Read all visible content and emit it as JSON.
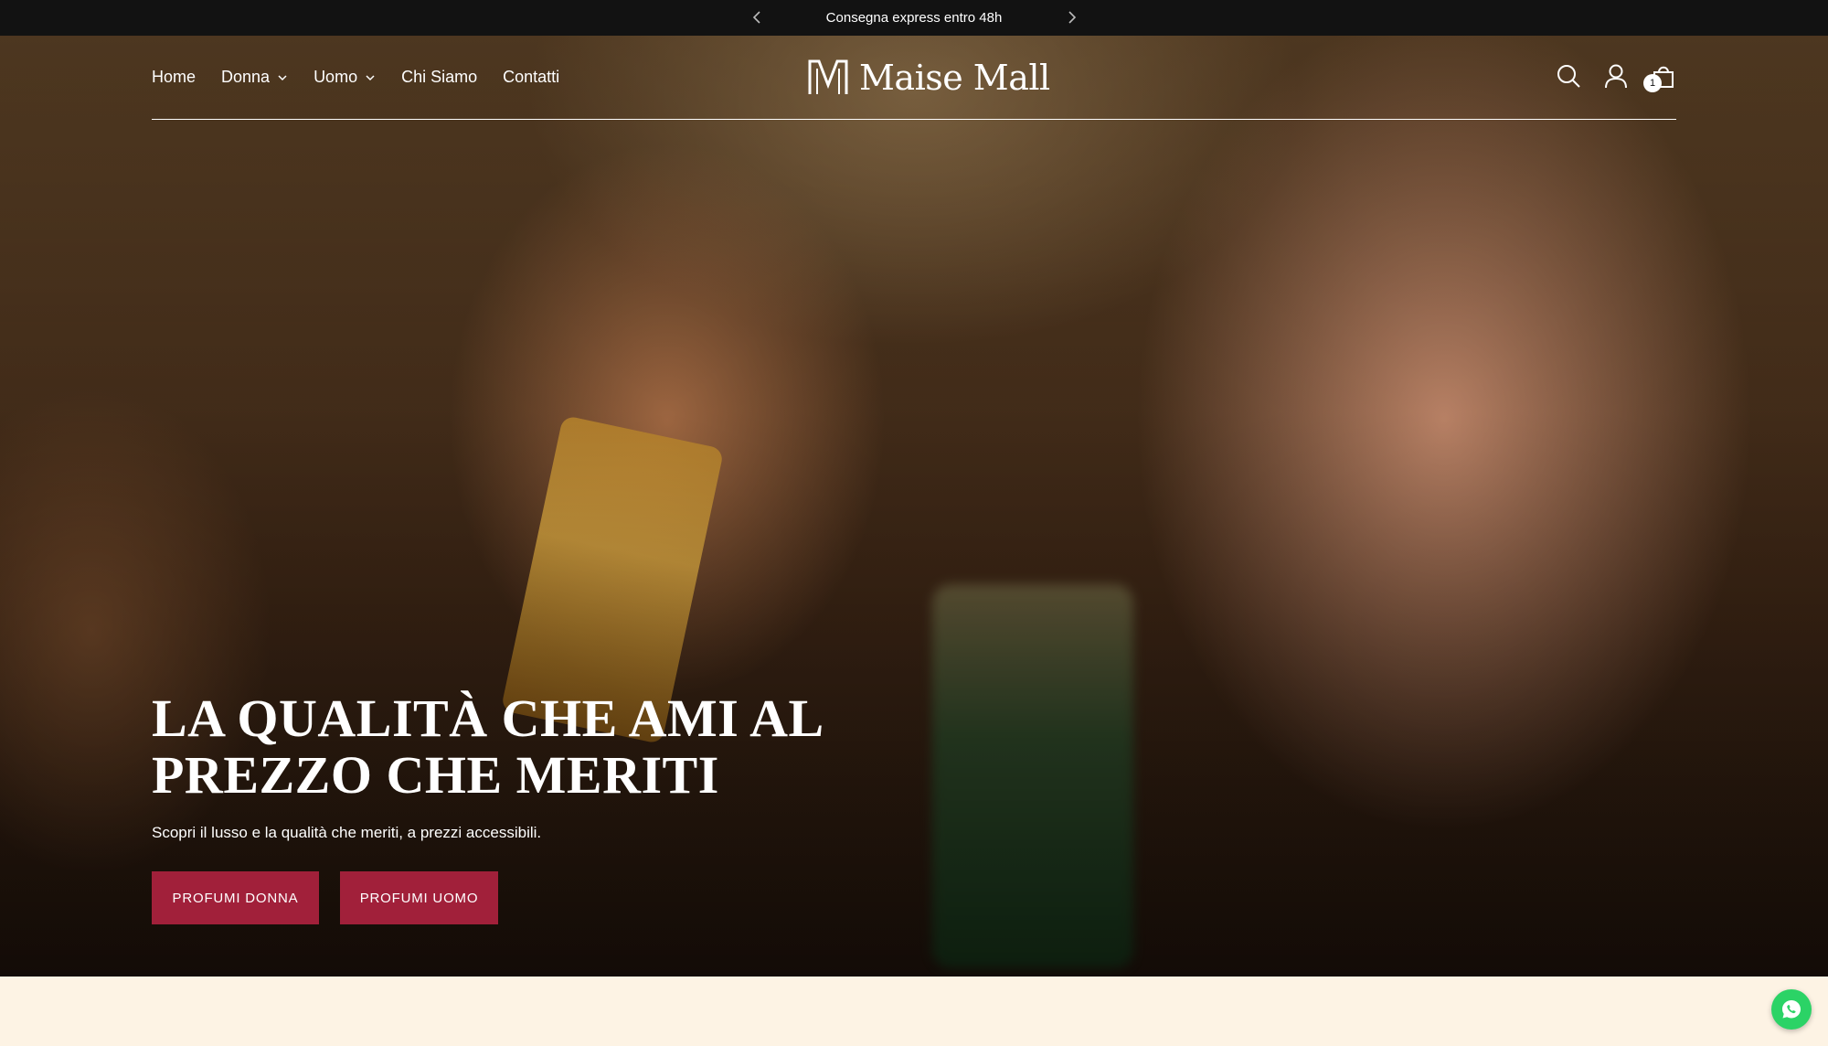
{
  "announcement": {
    "text": "Consegna express entro 48h",
    "prev_icon": "chevron-left-icon",
    "next_icon": "chevron-right-icon"
  },
  "header": {
    "nav": [
      {
        "label": "Home",
        "has_dropdown": false
      },
      {
        "label": "Donna",
        "has_dropdown": true
      },
      {
        "label": "Uomo",
        "has_dropdown": true
      },
      {
        "label": "Chi Siamo",
        "has_dropdown": false
      },
      {
        "label": "Contatti",
        "has_dropdown": false
      }
    ],
    "logo_text": "Maise Mall",
    "icons": [
      "search-icon",
      "account-icon",
      "cart-icon"
    ],
    "cart_count": "1"
  },
  "hero": {
    "title": "LA QUALITÀ CHE AMI AL PREZZO CHE MERITI",
    "subtitle": "Scopri il lusso e la qualità che meriti, a prezzi accessibili.",
    "buttons": [
      {
        "label": "PROFUMI DONNA"
      },
      {
        "label": "PROFUMI UOMO"
      }
    ]
  },
  "colors": {
    "announcement_bg": "#121212",
    "button_bg": "#a1203a",
    "cream_bg": "#fdf3e4",
    "whatsapp_green": "#2bd366"
  },
  "chat": {
    "icon": "whatsapp-icon"
  }
}
